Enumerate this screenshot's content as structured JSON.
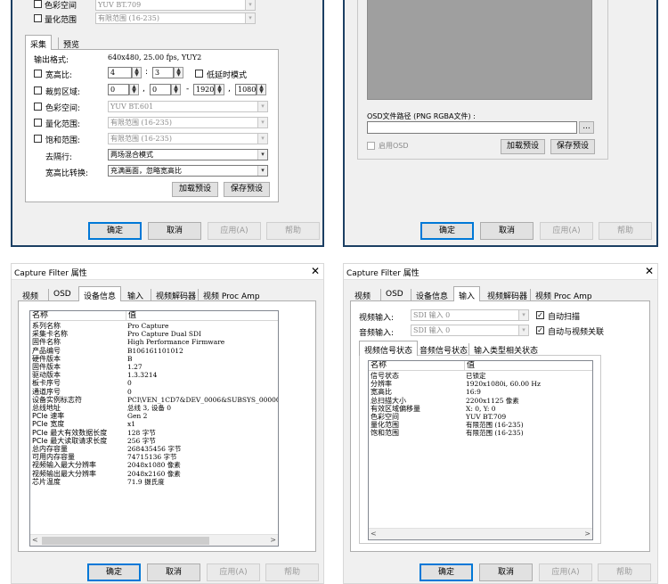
{
  "win_tl": {
    "top_rows": [
      {
        "label": "色彩空间",
        "value": "YUV BT.709"
      },
      {
        "label": "量化范围",
        "value": "有限范围 (16-235)"
      }
    ],
    "tabs": [
      "采集",
      "预览"
    ],
    "output_format_label": "输出格式:",
    "output_format_value": "640x480, 25.00 fps, YUY2",
    "aspect_label": "宽高比:",
    "aspect_w": "4",
    "aspect_colon": ":",
    "aspect_h": "3",
    "low_latency_label": "低延时模式",
    "crop_label": "裁剪区域:",
    "crop": [
      "0",
      "0",
      "1920",
      "1080"
    ],
    "crop_comma1": ",",
    "crop_dash": "-",
    "crop_comma2": ",",
    "colorspace_label": "色彩空间:",
    "colorspace_value": "YUV BT.601",
    "quant_label": "量化范围:",
    "quant_value": "有限范围 (16-235)",
    "sat_label": "饱和范围:",
    "sat_value": "有限范围 (16-235)",
    "deint_label": "去隔行:",
    "deint_value": "两场混合模式",
    "arconv_label": "宽高比转换:",
    "arconv_value": "充满画面，忽略宽高比",
    "load_preset": "加载预设",
    "save_preset": "保存预设",
    "ok": "确定",
    "cancel": "取消",
    "apply": "应用(A)",
    "help": "帮助"
  },
  "win_tr": {
    "osd_path_label": "OSD文件路径 (PNG RGBA文件) :",
    "browse": "...",
    "enable_osd": "启用OSD",
    "load_preset": "加载预设",
    "save_preset": "保存预设",
    "ok": "确定",
    "cancel": "取消",
    "apply": "应用(A)",
    "help": "帮助"
  },
  "win_bl": {
    "title": "Capture Filter 属性",
    "close": "✕",
    "tabs": [
      "视频",
      "OSD",
      "设备信息",
      "输入",
      "视频解码器",
      "视频 Proc Amp"
    ],
    "active_tab": 2,
    "col_name": "名称",
    "col_value": "值",
    "rows": [
      {
        "k": "系列名称",
        "v": "Pro Capture"
      },
      {
        "k": "采集卡名称",
        "v": "Pro Capture Dual SDI"
      },
      {
        "k": "固件名称",
        "v": "High Performance Firmware"
      },
      {
        "k": "产品编号",
        "v": "B106161101012"
      },
      {
        "k": "硬件版本",
        "v": "B"
      },
      {
        "k": "固件版本",
        "v": "1.27"
      },
      {
        "k": "驱动版本",
        "v": "1.3.3214"
      },
      {
        "k": "板卡序号",
        "v": "0"
      },
      {
        "k": "通道序号",
        "v": "0"
      },
      {
        "k": "设备实例标志符",
        "v": "PCI\\VEN_1CD7&DEV_0006&SUBSYS_00000001&"
      },
      {
        "k": "总线地址",
        "v": "总线 3, 设备 0"
      },
      {
        "k": "PCIe 速率",
        "v": "Gen 2"
      },
      {
        "k": "PCIe 宽度",
        "v": "x1"
      },
      {
        "k": "PCIe 最大有效数据长度",
        "v": "128 字节"
      },
      {
        "k": "PCIe 最大读取请求长度",
        "v": "256 字节"
      },
      {
        "k": "总内存容量",
        "v": "268435456 字节"
      },
      {
        "k": "可用内存容量",
        "v": "74715136 字节"
      },
      {
        "k": "视频输入最大分辨率",
        "v": "2048x1080 像素"
      },
      {
        "k": "视频输出最大分辨率",
        "v": "2048x2160 像素"
      },
      {
        "k": "芯片温度",
        "v": "71.9 摄氏度"
      }
    ],
    "scroll_left": "<",
    "scroll_right": ">",
    "ok": "确定",
    "cancel": "取消",
    "apply": "应用(A)",
    "help": "帮助"
  },
  "win_br": {
    "title": "Capture Filter 属性",
    "close": "✕",
    "tabs": [
      "视频",
      "OSD",
      "设备信息",
      "输入",
      "视频解码器",
      "视频 Proc Amp"
    ],
    "active_tab": 3,
    "video_input_label": "视频输入:",
    "video_input_value": "SDI 输入 0",
    "auto_scan_label": "自动扫描",
    "audio_input_label": "音频输入:",
    "audio_input_value": "SDI 输入 0",
    "audio_follow_label": "自动与视频关联",
    "subtabs": [
      "视频信号状态",
      "音频信号状态",
      "输入类型相关状态"
    ],
    "col_name": "名称",
    "col_value": "值",
    "rows": [
      {
        "k": "信号状态",
        "v": "已锁定"
      },
      {
        "k": "分辨率",
        "v": "1920x1080i, 60.00 Hz"
      },
      {
        "k": "宽高比",
        "v": "16:9"
      },
      {
        "k": "总扫描大小",
        "v": "2200x1125 像素"
      },
      {
        "k": "有效区域偏移量",
        "v": "X: 0, Y: 0"
      },
      {
        "k": "色彩空间",
        "v": "YUV BT.709"
      },
      {
        "k": "量化范围",
        "v": "有限范围 (16-235)"
      },
      {
        "k": "饱和范围",
        "v": "有限范围 (16-235)"
      }
    ],
    "scroll_left": "<",
    "scroll_right": ">",
    "ok": "确定",
    "cancel": "取消",
    "apply": "应用(A)",
    "help": "帮助"
  }
}
